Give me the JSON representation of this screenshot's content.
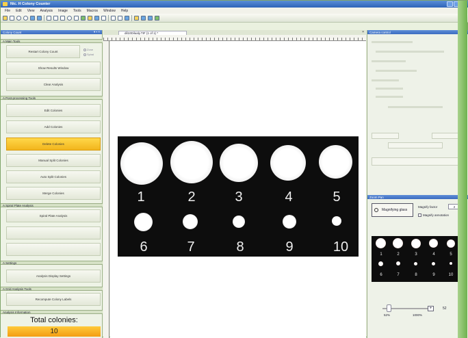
{
  "window": {
    "title": "Nic. H Colony Counter"
  },
  "menu": [
    "File",
    "Edit",
    "View",
    "Analysis",
    "Image",
    "Tools",
    "Macros",
    "Window",
    "Help"
  ],
  "left_panel": {
    "title": "Colony Count",
    "sections": {
      "main_tools": "A  Main Tools",
      "post_processing": "A  Post-processing Tools",
      "spiral": "A  Spiral Plate Analysis",
      "settings": "A  Settings",
      "grid": "A  Grid Analysis Tools",
      "info": "Analysis Information"
    },
    "buttons": {
      "restart": "Restart Colony Count",
      "show_results": "Show Results Window",
      "clear": "Clear Analysis",
      "edit": "Edit Colonies",
      "add": "Add Colonies",
      "delete": "Delete Colonies",
      "manual_split": "Manual Split Colonies",
      "auto_split": "Auto Split Colonies",
      "merge": "Merge Colonies",
      "spiral": "Spiral Plate Analysis",
      "settings": "Analysis Display Settings",
      "grid": "Recompute Colony Labels"
    },
    "radio": {
      "zone": "Zone",
      "spiral": "Spiral"
    },
    "total_label": "Total colonies:",
    "total_value": "10"
  },
  "document": {
    "tab_label": "dil10Dilualy.TIF (1 of 1) *",
    "colony_numbers": [
      "1",
      "2",
      "3",
      "4",
      "5",
      "6",
      "7",
      "8",
      "9",
      "10"
    ]
  },
  "right_panel": {
    "camera_title": "Camera control",
    "zoom_title": "Zoom Pan",
    "magnify_label": "Magnifying glass",
    "magnify_factor_label": "Magnify factor",
    "magnify_factor": "2",
    "magnify_annotation": "Magnify annotation",
    "zoom_value": "52",
    "zoom_min": "52%",
    "zoom_max": "1000%",
    "zoom_level_fraction": 0.06
  }
}
